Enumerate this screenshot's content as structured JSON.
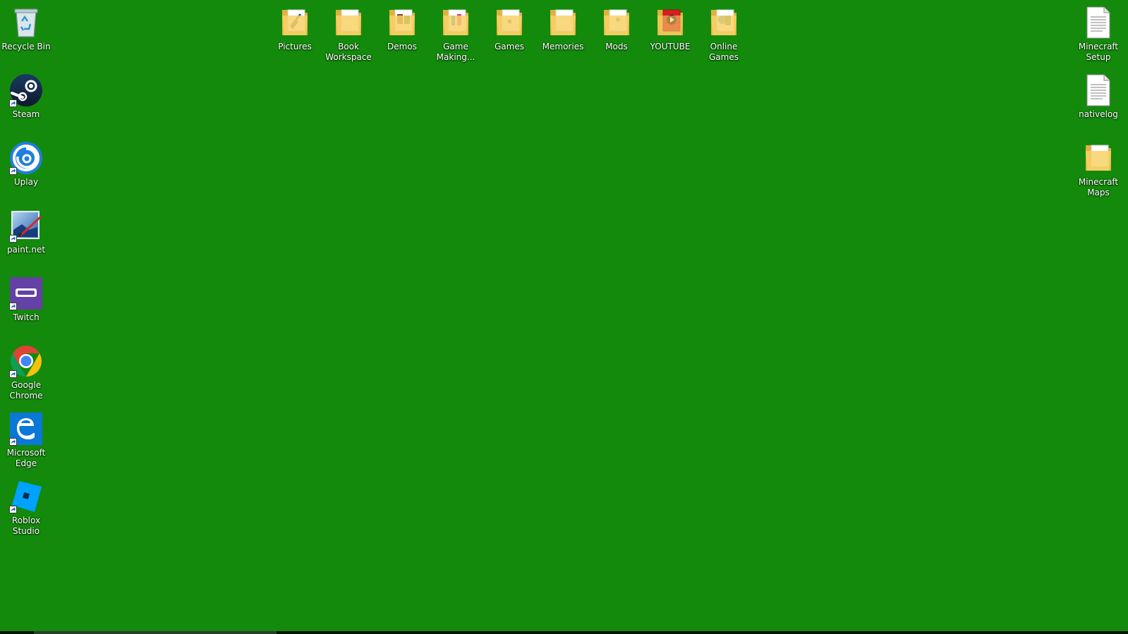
{
  "desktop": {
    "background_color": "#138a0c",
    "left_column": [
      {
        "id": "recycle-bin",
        "label": "Recycle Bin",
        "icon": "recycle-bin-icon",
        "shortcut": false
      },
      {
        "id": "steam",
        "label": "Steam",
        "icon": "steam-icon",
        "shortcut": true
      },
      {
        "id": "uplay",
        "label": "Uplay",
        "icon": "uplay-icon",
        "shortcut": true
      },
      {
        "id": "paint-net",
        "label": "paint.net",
        "icon": "paint-net-icon",
        "shortcut": true
      },
      {
        "id": "twitch",
        "label": "Twitch",
        "icon": "twitch-icon",
        "shortcut": true
      },
      {
        "id": "google-chrome",
        "label": "Google\nChrome",
        "icon": "chrome-icon",
        "shortcut": true
      },
      {
        "id": "microsoft-edge",
        "label": "Microsoft\nEdge",
        "icon": "edge-icon",
        "shortcut": true
      },
      {
        "id": "roblox-studio",
        "label": "Roblox\nStudio",
        "icon": "roblox-studio-icon",
        "shortcut": true
      }
    ],
    "top_row": [
      {
        "id": "pictures",
        "label": "Pictures",
        "icon": "folder-icon"
      },
      {
        "id": "book-workspace",
        "label": "Book\nWorkspace",
        "icon": "folder-icon"
      },
      {
        "id": "demos",
        "label": "Demos",
        "icon": "folder-icon"
      },
      {
        "id": "game-making",
        "label": "Game\nMaking...",
        "icon": "folder-icon"
      },
      {
        "id": "games",
        "label": "Games",
        "icon": "folder-icon"
      },
      {
        "id": "memories",
        "label": "Memories",
        "icon": "folder-icon"
      },
      {
        "id": "mods",
        "label": "Mods",
        "icon": "folder-icon"
      },
      {
        "id": "youtube",
        "label": "YOUTUBE",
        "icon": "folder-icon"
      },
      {
        "id": "online-games",
        "label": "Online\nGames",
        "icon": "folder-icon"
      }
    ],
    "right_column": [
      {
        "id": "minecraft-setup",
        "label": "Minecraft\nSetup",
        "icon": "text-file-icon"
      },
      {
        "id": "nativelog",
        "label": "nativelog",
        "icon": "text-file-icon"
      },
      {
        "id": "minecraft-maps",
        "label": "Minecraft\nMaps",
        "icon": "folder-icon"
      }
    ]
  }
}
